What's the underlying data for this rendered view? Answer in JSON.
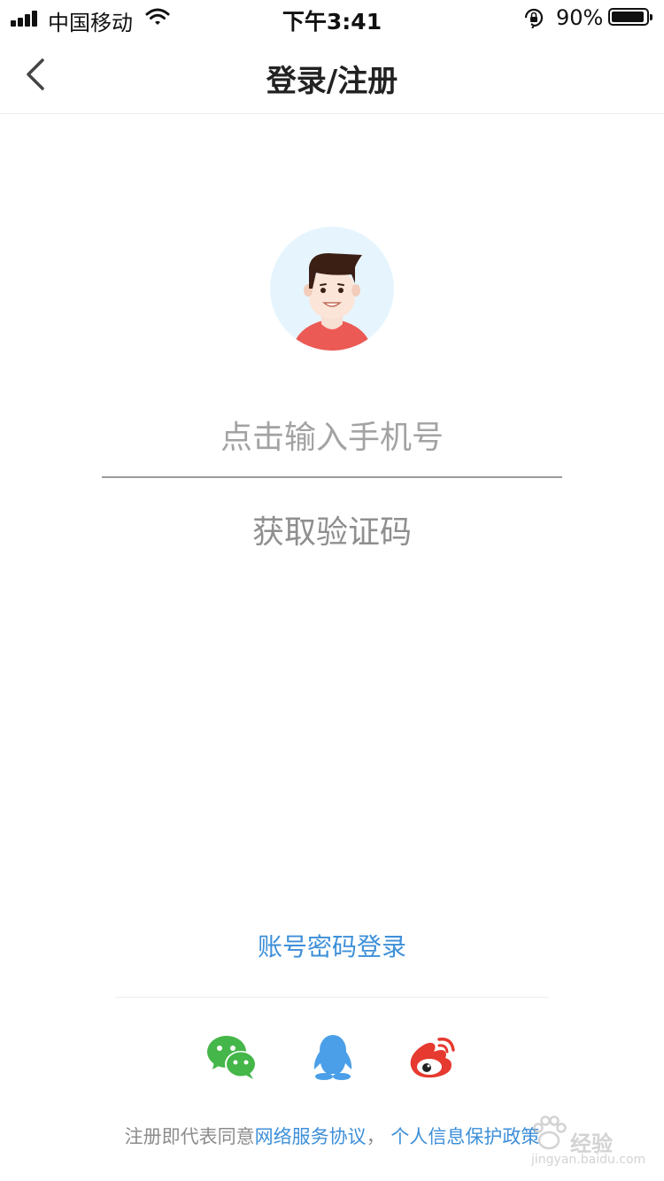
{
  "status_bar": {
    "carrier": "中国移动",
    "time": "下午3:41",
    "battery": "90%",
    "battery_level": 0.9
  },
  "nav": {
    "title": "登录/注册",
    "back_icon": "chevron-left-icon"
  },
  "avatar": {
    "icon": "user-avatar-icon"
  },
  "phone": {
    "placeholder": "点击输入手机号",
    "value": ""
  },
  "get_code_label": "获取验证码",
  "password_login_label": "账号密码登录",
  "social": [
    "wechat-icon",
    "qq-icon",
    "weibo-icon"
  ],
  "social_colors": {
    "wechat": "#45b649",
    "qq": "#4a9fe8",
    "weibo": "#e6392f"
  },
  "agreement": {
    "prefix": "注册即代表同意",
    "service_link": "网络服务协议",
    "separator": "，",
    "privacy_link": "个人信息保护政策"
  },
  "watermark": {
    "text": "经验",
    "url": "jingyan.baidu.com"
  },
  "colors": {
    "accent": "#3d8fd9",
    "placeholder": "#a3a3a3"
  }
}
